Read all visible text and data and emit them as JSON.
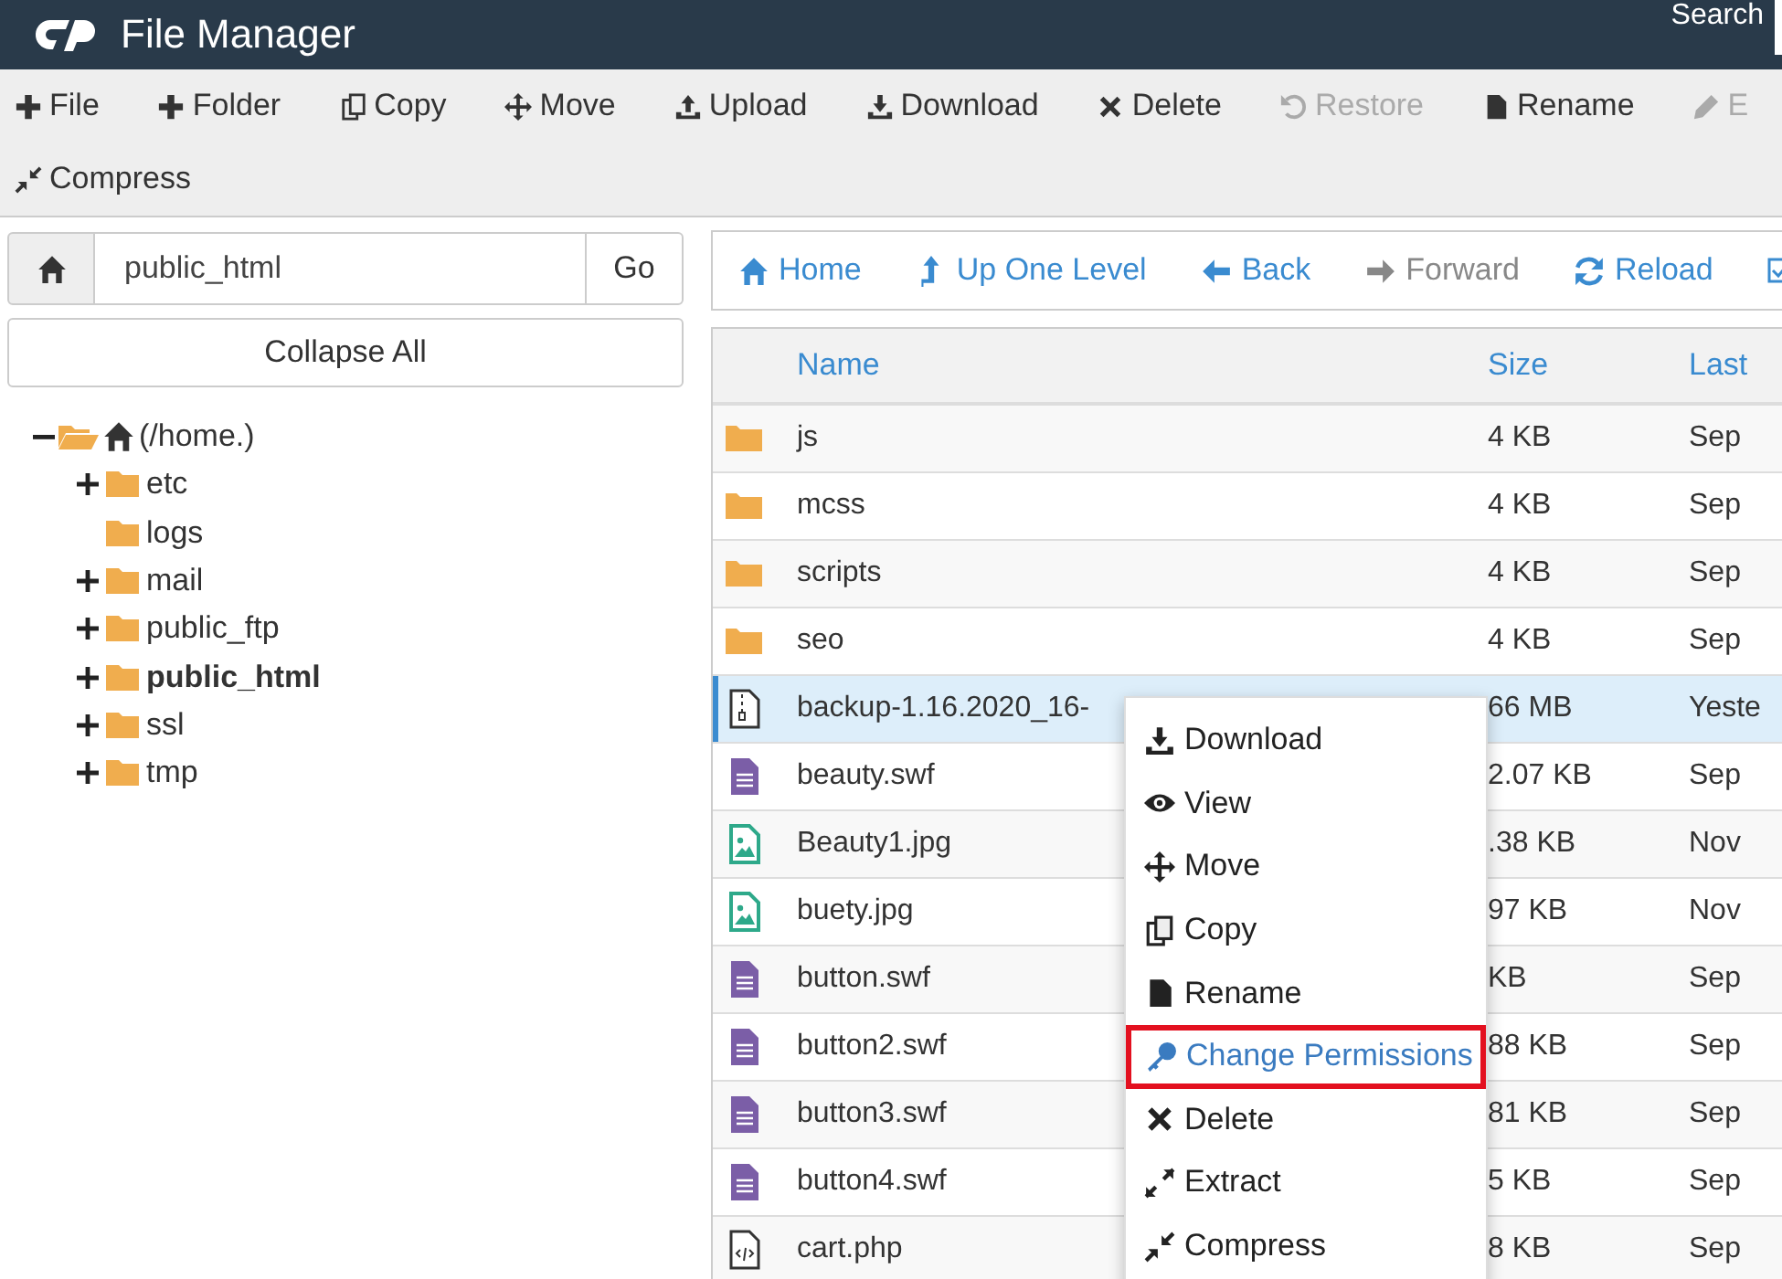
{
  "header": {
    "title": "File Manager",
    "search_label": "Search"
  },
  "toolbar": [
    {
      "label": "File",
      "kind": "plus",
      "disabled": false
    },
    {
      "label": "Folder",
      "kind": "plus",
      "disabled": false
    },
    {
      "label": "Copy",
      "kind": "copy",
      "disabled": false
    },
    {
      "label": "Move",
      "kind": "move",
      "disabled": false
    },
    {
      "label": "Upload",
      "kind": "upload",
      "disabled": false
    },
    {
      "label": "Download",
      "kind": "download",
      "disabled": false
    },
    {
      "label": "Delete",
      "kind": "delete",
      "disabled": false
    },
    {
      "label": "Restore",
      "kind": "undo",
      "disabled": true
    },
    {
      "label": "Rename",
      "kind": "file",
      "disabled": false
    },
    {
      "label": "E",
      "kind": "pencil",
      "disabled": true
    },
    {
      "label": "Compress",
      "kind": "compress",
      "disabled": false
    }
  ],
  "path_bar": {
    "value": "public_html",
    "go_label": "Go"
  },
  "collapse_label": "Collapse All",
  "tree": [
    {
      "label": "(/home.)",
      "kind": "home",
      "expandable": true,
      "expanded": true,
      "selected": false,
      "children": [
        {
          "label": "etc",
          "kind": "folder",
          "expandable": true,
          "expanded": false,
          "selected": false
        },
        {
          "label": "logs",
          "kind": "folder",
          "expandable": false,
          "expanded": false,
          "selected": false
        },
        {
          "label": "mail",
          "kind": "folder",
          "expandable": true,
          "expanded": false,
          "selected": false
        },
        {
          "label": "public_ftp",
          "kind": "folder",
          "expandable": true,
          "expanded": false,
          "selected": false
        },
        {
          "label": "public_html",
          "kind": "folder",
          "expandable": true,
          "expanded": false,
          "selected": true
        },
        {
          "label": "ssl",
          "kind": "folder",
          "expandable": true,
          "expanded": false,
          "selected": false
        },
        {
          "label": "tmp",
          "kind": "folder",
          "expandable": true,
          "expanded": false,
          "selected": false
        }
      ]
    }
  ],
  "nav": [
    {
      "label": "Home",
      "kind": "home",
      "disabled": false
    },
    {
      "label": "Up One Level",
      "kind": "up",
      "disabled": false
    },
    {
      "label": "Back",
      "kind": "back",
      "disabled": false
    },
    {
      "label": "Forward",
      "kind": "forward",
      "disabled": true
    },
    {
      "label": "Reload",
      "kind": "reload",
      "disabled": false
    }
  ],
  "table": {
    "columns": [
      "Name",
      "Size",
      "Last"
    ],
    "rows": [
      {
        "kind": "folder",
        "name": "js",
        "size": "4 KB",
        "date": "Sep",
        "selected": false
      },
      {
        "kind": "folder",
        "name": "mcss",
        "size": "4 KB",
        "date": "Sep",
        "selected": false
      },
      {
        "kind": "folder",
        "name": "scripts",
        "size": "4 KB",
        "date": "Sep",
        "selected": false
      },
      {
        "kind": "folder",
        "name": "seo",
        "size": "4 KB",
        "date": "Sep",
        "selected": false
      },
      {
        "kind": "archive",
        "name": "backup-1.16.2020_16-",
        "size": "66 MB",
        "date": "Yeste",
        "selected": true
      },
      {
        "kind": "text",
        "name": "beauty.swf",
        "size": "2.07 KB",
        "date": "Sep",
        "selected": false
      },
      {
        "kind": "image",
        "name": "Beauty1.jpg",
        "size": ".38 KB",
        "date": "Nov",
        "selected": false
      },
      {
        "kind": "image",
        "name": "buety.jpg",
        "size": "97 KB",
        "date": "Nov",
        "selected": false
      },
      {
        "kind": "text",
        "name": "button.swf",
        "size": "KB",
        "date": "Sep",
        "selected": false
      },
      {
        "kind": "text",
        "name": "button2.swf",
        "size": "88 KB",
        "date": "Sep",
        "selected": false
      },
      {
        "kind": "text",
        "name": "button3.swf",
        "size": "81 KB",
        "date": "Sep",
        "selected": false
      },
      {
        "kind": "text",
        "name": "button4.swf",
        "size": "5 KB",
        "date": "Sep",
        "selected": false
      },
      {
        "kind": "code",
        "name": "cart.php",
        "size": "8 KB",
        "date": "Sep",
        "selected": false
      }
    ]
  },
  "context_menu": [
    {
      "label": "Download",
      "kind": "download",
      "selected": false
    },
    {
      "label": "View",
      "kind": "eye",
      "selected": false
    },
    {
      "label": "Move",
      "kind": "move",
      "selected": false
    },
    {
      "label": "Copy",
      "kind": "copy",
      "selected": false
    },
    {
      "label": "Rename",
      "kind": "file",
      "selected": false
    },
    {
      "label": "Change Permissions",
      "kind": "key",
      "selected": true
    },
    {
      "label": "Delete",
      "kind": "delete",
      "selected": false
    },
    {
      "label": "Extract",
      "kind": "expand",
      "selected": false
    },
    {
      "label": "Compress",
      "kind": "compress",
      "selected": false
    }
  ]
}
